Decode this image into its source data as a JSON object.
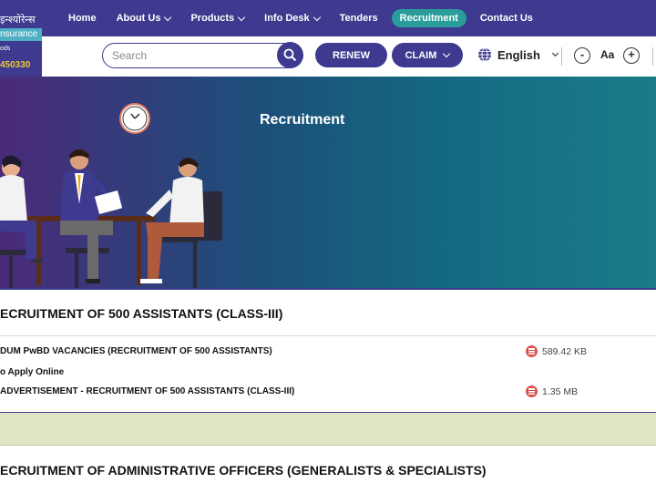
{
  "logo": {
    "hindi": "इन्श्योरेन्स",
    "english": "nsurance",
    "tagline": "ods",
    "phone": "450330"
  },
  "nav": {
    "items": [
      {
        "label": "Home",
        "dropdown": false
      },
      {
        "label": "About Us",
        "dropdown": true
      },
      {
        "label": "Products",
        "dropdown": true
      },
      {
        "label": "Info Desk",
        "dropdown": true
      },
      {
        "label": "Tenders",
        "dropdown": false
      },
      {
        "label": "Recruitment",
        "dropdown": false,
        "active": true
      },
      {
        "label": "Contact Us",
        "dropdown": false
      }
    ]
  },
  "toolbar": {
    "search_placeholder": "Search",
    "renew_label": "RENEW",
    "claim_label": "CLAIM",
    "language": "English",
    "font_decrease": "-",
    "font_label": "Aa",
    "font_increase": "+"
  },
  "banner": {
    "title": "Recruitment"
  },
  "sections": [
    {
      "title": "ECRUITMENT OF 500 ASSISTANTS (CLASS-III)",
      "rows": [
        {
          "text": "DUM PwBD VACANCIES (RECRUITMENT OF 500 ASSISTANTS)",
          "size": "589.42 KB"
        },
        {
          "text": "o Apply Online",
          "size": ""
        },
        {
          "text": "ADVERTISEMENT - RECRUITMENT OF 500 ASSISTANTS (CLASS-III)",
          "size": "1.35 MB"
        }
      ]
    },
    {
      "title": "ECRUITMENT OF ADMINISTRATIVE OFFICERS (GENERALISTS & SPECIALISTS)",
      "rows": []
    }
  ],
  "colors": {
    "primary": "#3d3a8f",
    "accent": "#2a9d9a",
    "highlight_row": "#dfe6c5",
    "pdf_icon": "#d9534f"
  }
}
